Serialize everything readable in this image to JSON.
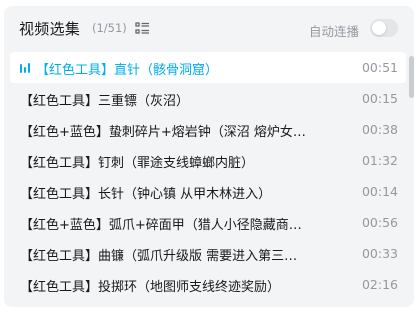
{
  "header": {
    "title": "视频选集",
    "count": "(1/51)",
    "list_icon": "list-view-icon",
    "autoplay_label": "自动连播",
    "autoplay_on": false
  },
  "playlist": {
    "items": [
      {
        "title": "【红色工具】直针（骸骨洞窟）",
        "duration": "00:51",
        "active": true
      },
      {
        "title": "【红色工具】三重镖（灰沼）",
        "duration": "00:15",
        "active": false
      },
      {
        "title": "【红色+蓝色】蛰刺碎片+熔岩钟（深沼 熔炉女…",
        "duration": "00:38",
        "active": false
      },
      {
        "title": "【红色工具】钉刺（罪途支线蟑螂内脏）",
        "duration": "01:32",
        "active": false
      },
      {
        "title": "【红色工具】长针（钟心镇 从甲木林进入）",
        "duration": "00:14",
        "active": false
      },
      {
        "title": "【红色+蓝色】弧爪+碎面甲（猎人小径隐藏商…",
        "duration": "00:56",
        "active": false
      },
      {
        "title": "【红色工具】曲镰（弧爪升级版 需要进入第三…",
        "duration": "00:33",
        "active": false
      },
      {
        "title": "【红色工具】投掷环（地图师支线终迹奖励）",
        "duration": "02:16",
        "active": false
      }
    ]
  },
  "colors": {
    "accent": "#00aeec",
    "text": "#18191c",
    "muted": "#9499a0",
    "panel_bg": "#f3f4f6"
  }
}
